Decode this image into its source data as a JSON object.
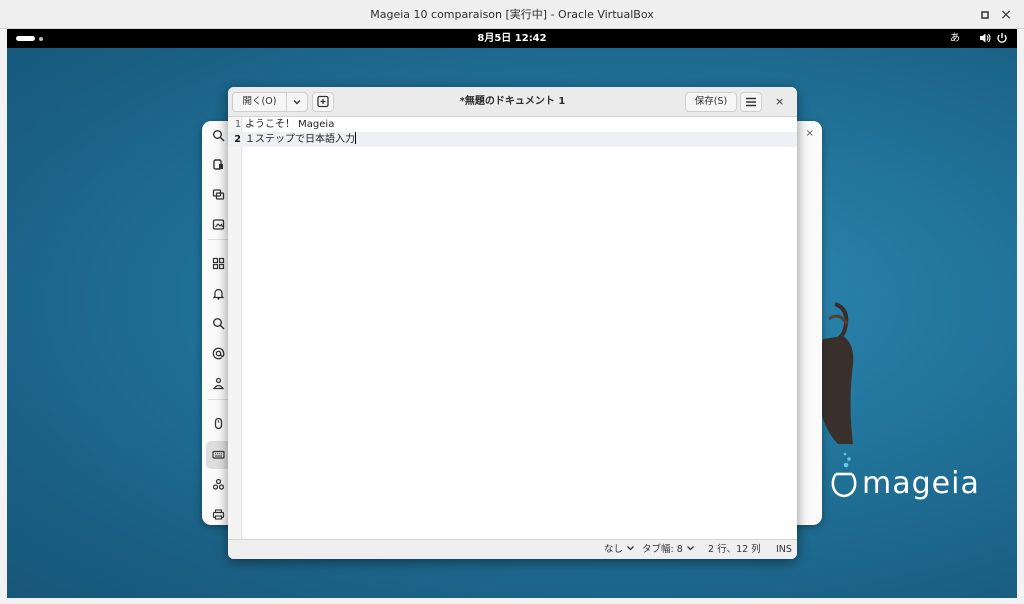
{
  "host": {
    "title": "Mageia 10 comparaison [実行中] - Oracle VirtualBox",
    "minimize_glyph": "▫",
    "close_glyph": "×"
  },
  "topbar": {
    "clock": "8月5日  12:42",
    "input_method": "あ",
    "icons": [
      "activities-indicator",
      "volume-icon",
      "power-icon"
    ]
  },
  "settings_window": {
    "sidebar_icons": [
      "wifi-icon",
      "displays-icon",
      "background-icon",
      "apps-icon",
      "notifications-icon",
      "search-icon",
      "online-accounts-icon",
      "sharing-icon",
      "mouse-icon",
      "keyboard-icon",
      "accessibility-icon",
      "printers-icon"
    ],
    "close_glyph": "×"
  },
  "gedit": {
    "open_label": "開く(O)",
    "dropdown_glyph": "⌄",
    "new_tab_glyph": "+",
    "title": "*無題のドキュメント 1",
    "save_label": "保存(S)",
    "close_glyph": "×",
    "lines": [
      {
        "number": "1",
        "text": "ようこそ！ Mageia"
      },
      {
        "number": "2",
        "text": "１ステップで日本語入力"
      }
    ],
    "status": {
      "language": "なし",
      "tab_width": "タブ幅: 8",
      "position": "2 行、12 列",
      "mode": "INS"
    }
  },
  "branding": {
    "wordmark": "mageia"
  }
}
